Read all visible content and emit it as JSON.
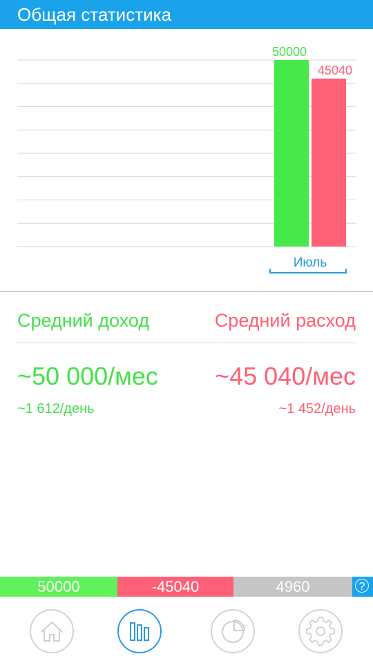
{
  "header": {
    "title": "Общая статистика"
  },
  "colors": {
    "accent": "#1aa3ea",
    "income": "#46e04a",
    "expense": "#ff6075",
    "balance": "#c5c5c5"
  },
  "chart_data": {
    "type": "bar",
    "categories": [
      "Июль"
    ],
    "series": [
      {
        "values": [
          50000
        ],
        "color": "#46e84a"
      },
      {
        "values": [
          45040
        ],
        "color": "#ff6077"
      }
    ],
    "value_labels": [
      "50000",
      "45040"
    ],
    "ylim": [
      0,
      50000
    ],
    "grid": true
  },
  "stats": {
    "income_label": "Средний доход",
    "expense_label": "Средний расход",
    "income_month": "~50 000/мес",
    "expense_month": "~45 040/мес",
    "income_day": "~1 612/день",
    "expense_day": "~1 452/день"
  },
  "balance": {
    "income": "50000",
    "expense": "-45040",
    "balance": "4960",
    "help_icon": "?"
  },
  "tabs": [
    {
      "icon": "home-icon",
      "active": false
    },
    {
      "icon": "bar-chart-icon",
      "active": true
    },
    {
      "icon": "pie-chart-icon",
      "active": false
    },
    {
      "icon": "gear-icon",
      "active": false
    }
  ]
}
